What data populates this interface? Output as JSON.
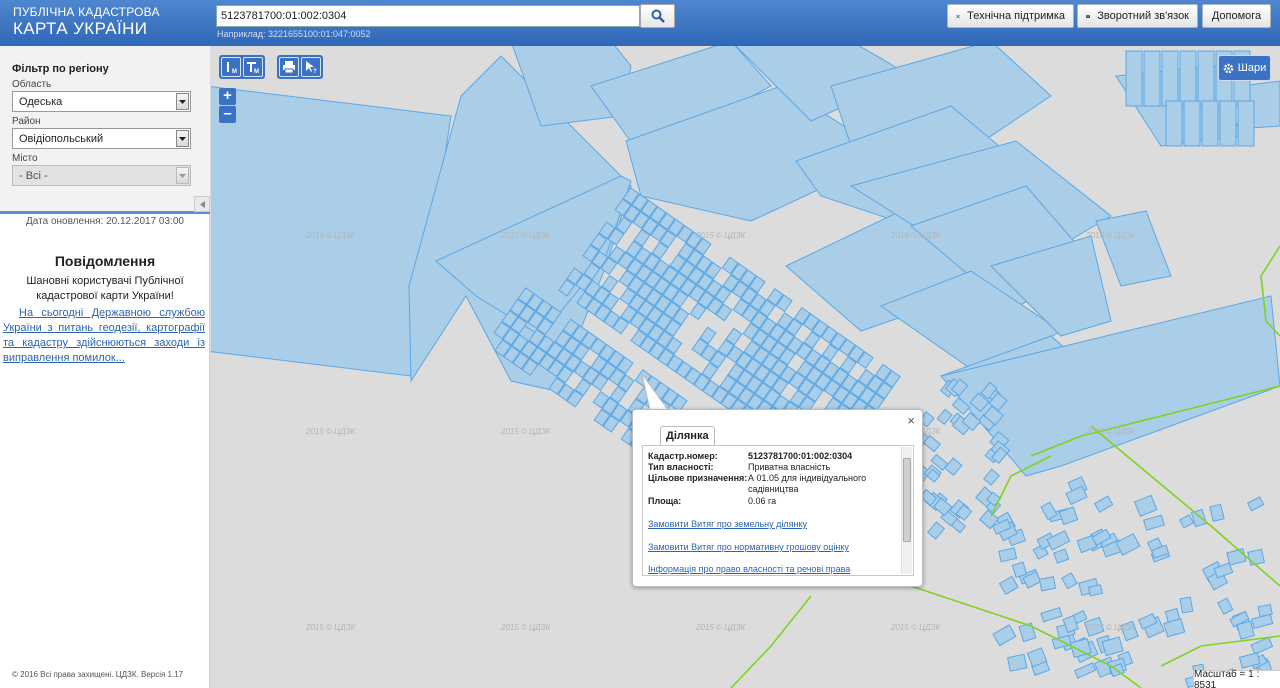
{
  "header": {
    "logo_line1": "ПУБЛІЧНА КАДАСТРОВА",
    "logo_line2": "КАРТА УКРАЇНИ",
    "search_value": "5123781700:01:002:0304",
    "search_example": "Наприклад: 3221655100:01:047:0052",
    "support_label": "Технічна підтримка",
    "feedback_label": "Зворотний зв'язок",
    "help_label": "Допомога"
  },
  "filter": {
    "title": "Фільтр по регіону",
    "region_label": "Область",
    "region_value": "Одеська",
    "district_label": "Район",
    "district_value": "Овідіопольський",
    "city_label": "Місто",
    "city_value": "- Всі -"
  },
  "sidebar": {
    "update_date": "Дата оновлення: 20.12.2017 03:00",
    "notice_title": "Повідомлення",
    "notice_text": "Шановні користувачі Публічної кадастрової карти України!",
    "notice_link": "На сьогодні Державною службою України з питань геодезії, картографії та кадастру здійснюються заходи із виправлення помилок...",
    "footer": "© 2016 Всі права захищені. ЦДЗК. Версія 1.17"
  },
  "map": {
    "watermark": "2015 © ЦДЗК",
    "layers_label": "Шари",
    "scale_label": "Масштаб = 1 : 8531",
    "zoom_in": "+",
    "zoom_out": "–",
    "colors": {
      "parcel_fill": "#aacde8",
      "parcel_stroke": "#5aa8e6",
      "boundary": "#7ed321",
      "background": "#dcdcdc"
    }
  },
  "popup": {
    "tab_label": "Ділянка",
    "close": "×",
    "rows": [
      {
        "key": "Кадастр.номер:",
        "value": "5123781700:01:002:0304"
      },
      {
        "key": "Тип власності:",
        "value": "Приватна власність"
      },
      {
        "key": "Цільове призначення:",
        "value": "А 01.05 для індивідуального садівництва"
      },
      {
        "key": "Площа:",
        "value": "0.06 га"
      }
    ],
    "link_extract": "Замовити Витяг про земельну ділянку",
    "link_valuation": "Замовити Витяг про нормативну грошову оцінку",
    "link_rights": "Інформація про право власності та речові права"
  }
}
